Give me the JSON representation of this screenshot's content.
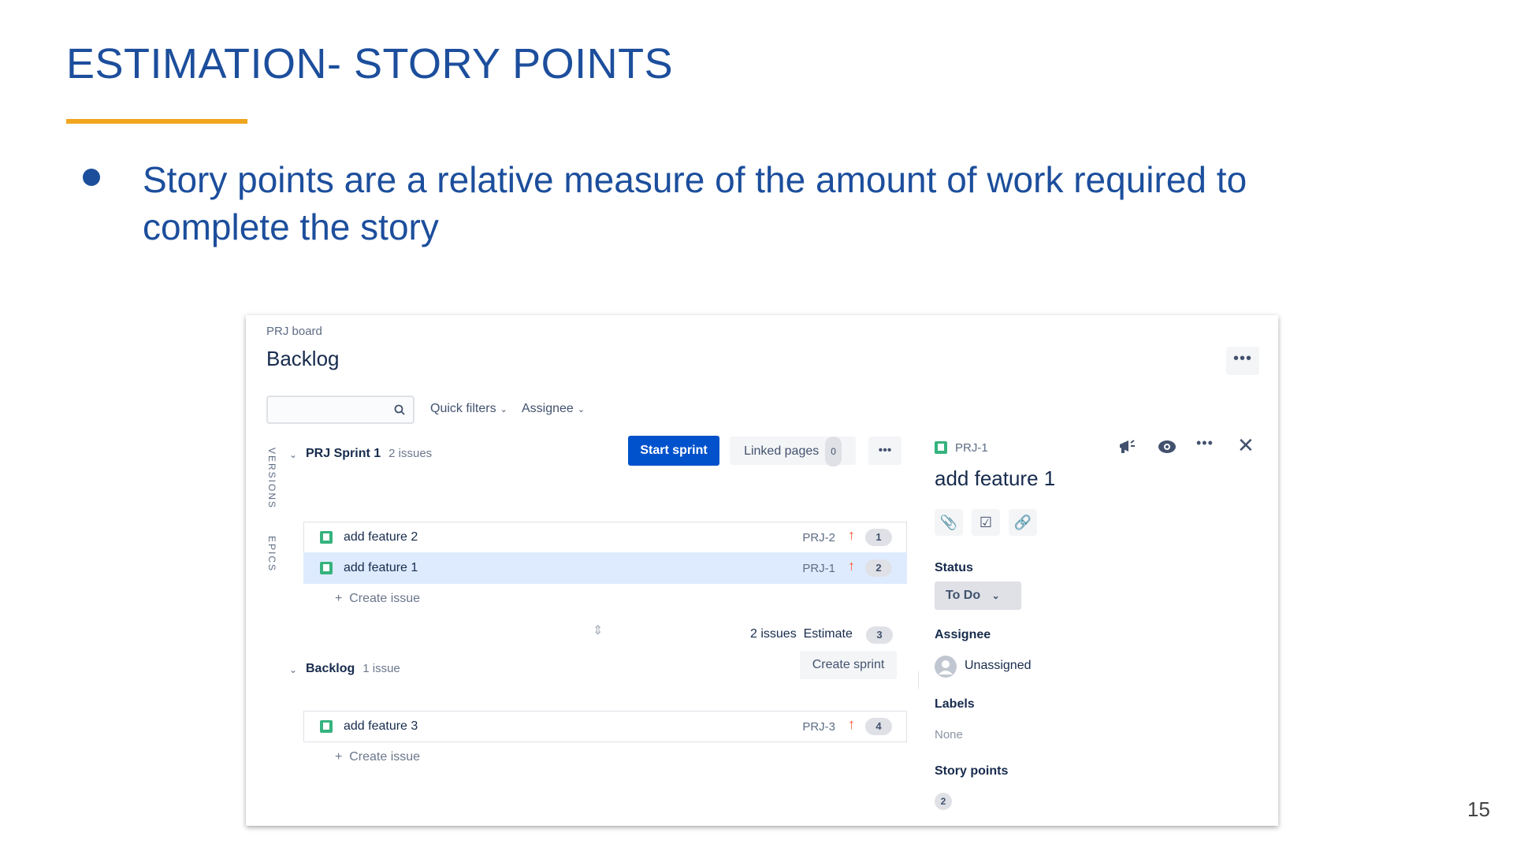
{
  "slide": {
    "title": "ESTIMATION- STORY POINTS",
    "bullet": "Story points are a relative measure of the amount of work required to complete the story",
    "page_number": "15"
  },
  "board": {
    "breadcrumb": "PRJ board",
    "title": "Backlog",
    "more_label": "•••",
    "quick_filters": "Quick filters",
    "assignee_filter": "Assignee",
    "side_tabs": [
      "VERSIONS",
      "EPICS"
    ]
  },
  "sprint": {
    "name": "PRJ Sprint 1",
    "count": "2 issues",
    "start_button": "Start sprint",
    "linked_pages": "Linked pages",
    "linked_pages_count": "0",
    "more_label": "•••",
    "issues": [
      {
        "summary": "add feature 2",
        "key": "PRJ-2",
        "points": "1"
      },
      {
        "summary": "add feature 1",
        "key": "PRJ-1",
        "points": "2"
      }
    ],
    "create_issue": "Create issue",
    "footer_count": "2 issues",
    "estimate_label": "Estimate",
    "estimate_total": "3"
  },
  "backlog": {
    "name": "Backlog",
    "count": "1 issue",
    "create_sprint": "Create sprint",
    "issues": [
      {
        "summary": "add feature 3",
        "key": "PRJ-3",
        "points": "4"
      }
    ],
    "create_issue": "Create issue"
  },
  "detail": {
    "key": "PRJ-1",
    "title": "add feature 1",
    "more_label": "•••",
    "status_label": "Status",
    "status_value": "To Do",
    "assignee_label": "Assignee",
    "assignee_value": "Unassigned",
    "labels_label": "Labels",
    "labels_value": "None",
    "story_points_label": "Story points",
    "story_points_value": "2"
  },
  "colors": {
    "title_blue": "#1c4e9c",
    "underline_orange": "#f0a51e",
    "primary_button": "#0052cc",
    "story_green": "#36b37e",
    "priority_orange": "#ff5630",
    "selected_row": "#deebff"
  }
}
